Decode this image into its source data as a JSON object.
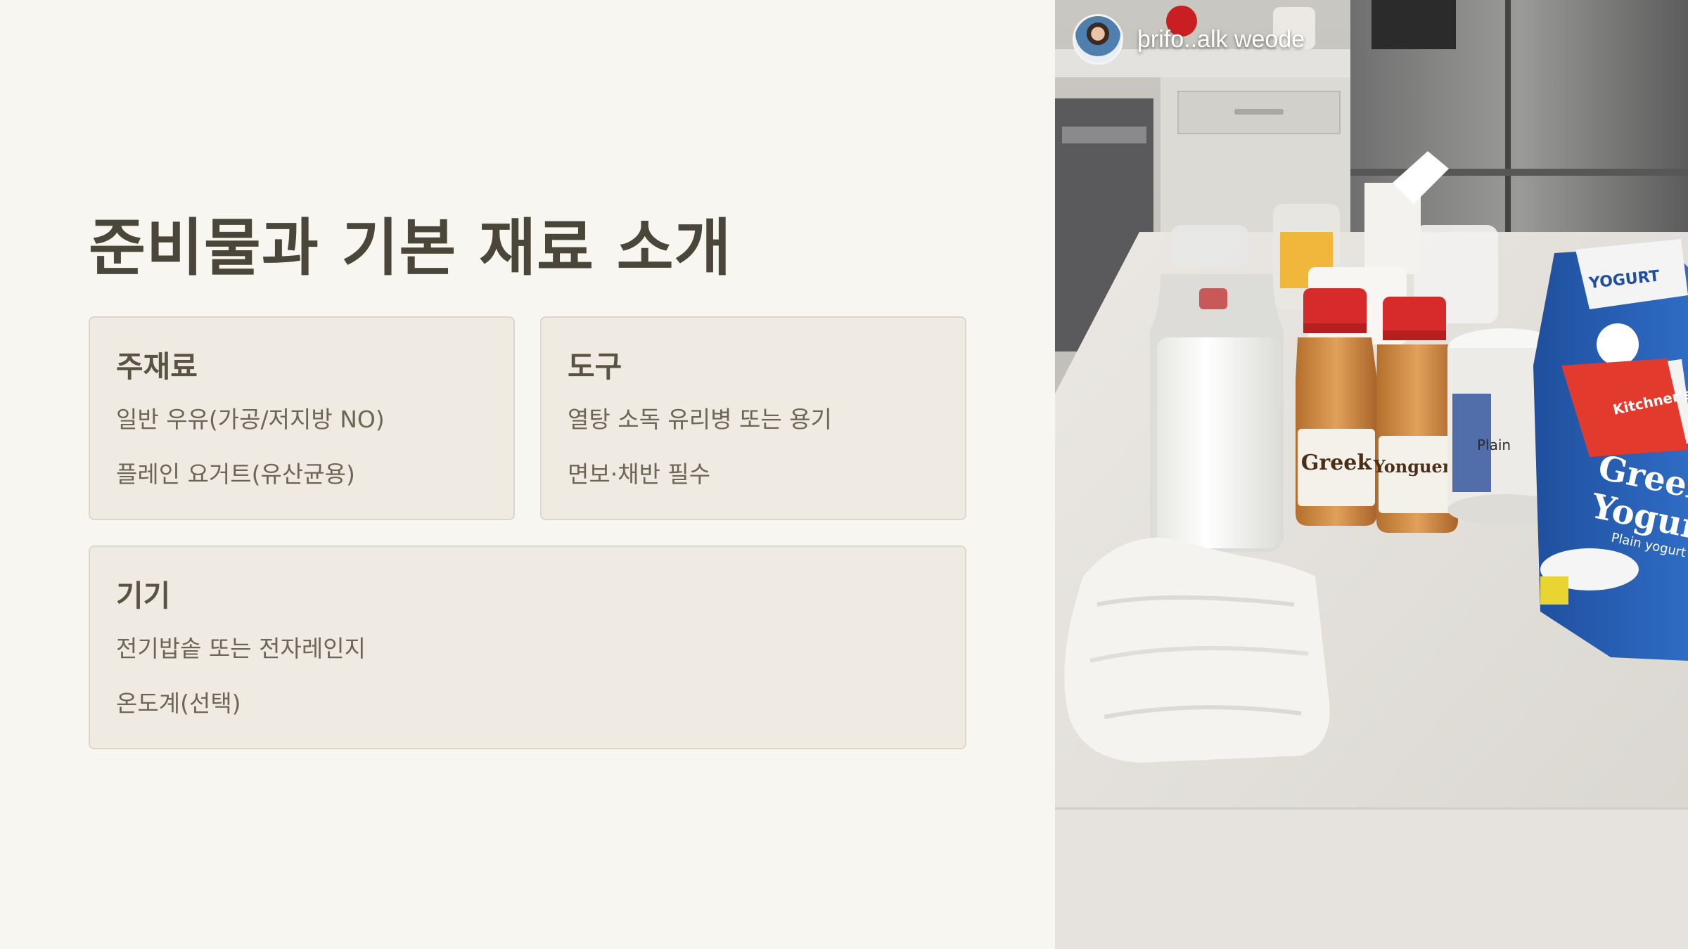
{
  "slide": {
    "title": "준비물과 기본 재료 소개"
  },
  "cards": {
    "main": {
      "title": "주재료",
      "items": [
        "일반 우유(가공/저지방 NO)",
        "플레인 요거트(유산균용)"
      ]
    },
    "tools": {
      "title": "도구",
      "items": [
        "열탕 소독 유리병 또는 용기",
        "면보·채반 필수"
      ]
    },
    "appliances": {
      "title": "기기",
      "items": [
        "전기밥솥 또는 전자레인지",
        "온도계(선택)"
      ]
    }
  },
  "photo": {
    "author": "þrifo..alk weode",
    "labels": {
      "bottle_left": "Greek",
      "bottle_right": "Yonguent",
      "tub": "Plain",
      "carton_top": "YOGURT",
      "carton_brand": "Kitchner's",
      "carton_main_1": "Greek",
      "carton_main_2": "Yogurt",
      "carton_sub": "Plain yogurt"
    }
  }
}
